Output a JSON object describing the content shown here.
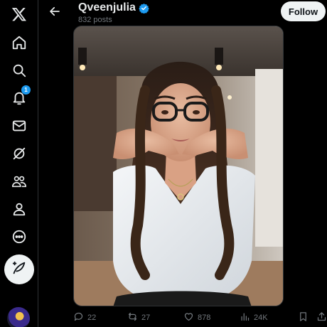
{
  "nav": {
    "items": [
      {
        "name": "x-logo-icon"
      },
      {
        "name": "home-icon"
      },
      {
        "name": "explore-icon"
      },
      {
        "name": "notifications-icon",
        "badge": "1"
      },
      {
        "name": "messages-icon"
      },
      {
        "name": "grok-icon"
      },
      {
        "name": "communities-icon"
      },
      {
        "name": "profile-icon"
      },
      {
        "name": "more-icon"
      }
    ],
    "post_button_icon": "compose-feather-icon"
  },
  "header": {
    "name": "Qveenjulia",
    "verified": true,
    "post_count": "832 posts",
    "follow_label": "Follow"
  },
  "actions": {
    "replies": "22",
    "reposts": "27",
    "likes": "878",
    "views": "24K"
  },
  "colors": {
    "accent": "#1d9bf0",
    "text_primary": "#e7e9ea",
    "text_secondary": "#71767b",
    "background": "#000000"
  }
}
